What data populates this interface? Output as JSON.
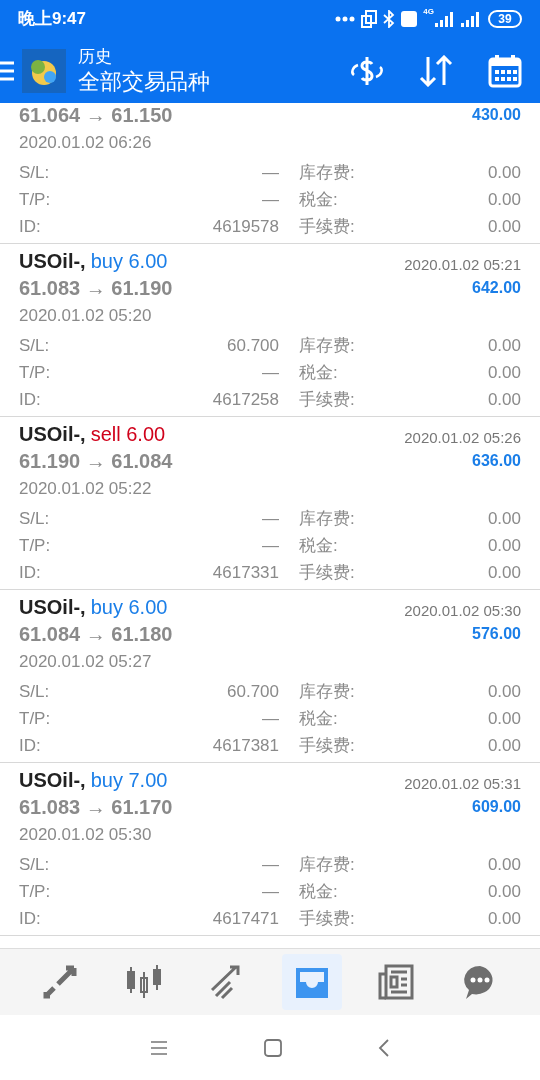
{
  "status_bar": {
    "time": "晚上9:47",
    "network": "4G",
    "battery": "39"
  },
  "header": {
    "title": "历史",
    "subtitle": "全部交易品种"
  },
  "trades": [
    {
      "prices": "61.064 → 61.150",
      "profit": "430.00",
      "open_time": "2020.01.02 06:26",
      "rows": [
        {
          "label": "S/L:",
          "value": "—",
          "label2": "库存费:",
          "value2": "0.00"
        },
        {
          "label": "T/P:",
          "value": "—",
          "label2": "税金:",
          "value2": "0.00"
        },
        {
          "label": "ID:",
          "value": "4619578",
          "label2": "手续费:",
          "value2": "0.00"
        }
      ]
    },
    {
      "symbol": "USOil-,",
      "kind": "buy",
      "action": "buy 6.00",
      "close_time": "2020.01.02 05:21",
      "prices": "61.083 → 61.190",
      "profit": "642.00",
      "open_time": "2020.01.02 05:20",
      "rows": [
        {
          "label": "S/L:",
          "value": "60.700",
          "label2": "库存费:",
          "value2": "0.00"
        },
        {
          "label": "T/P:",
          "value": "—",
          "label2": "税金:",
          "value2": "0.00"
        },
        {
          "label": "ID:",
          "value": "4617258",
          "label2": "手续费:",
          "value2": "0.00"
        }
      ]
    },
    {
      "symbol": "USOil-,",
      "kind": "sell",
      "action": "sell 6.00",
      "close_time": "2020.01.02 05:26",
      "prices": "61.190 → 61.084",
      "profit": "636.00",
      "open_time": "2020.01.02 05:22",
      "rows": [
        {
          "label": "S/L:",
          "value": "—",
          "label2": "库存费:",
          "value2": "0.00"
        },
        {
          "label": "T/P:",
          "value": "—",
          "label2": "税金:",
          "value2": "0.00"
        },
        {
          "label": "ID:",
          "value": "4617331",
          "label2": "手续费:",
          "value2": "0.00"
        }
      ]
    },
    {
      "symbol": "USOil-,",
      "kind": "buy",
      "action": "buy 6.00",
      "close_time": "2020.01.02 05:30",
      "prices": "61.084 → 61.180",
      "profit": "576.00",
      "open_time": "2020.01.02 05:27",
      "rows": [
        {
          "label": "S/L:",
          "value": "60.700",
          "label2": "库存费:",
          "value2": "0.00"
        },
        {
          "label": "T/P:",
          "value": "—",
          "label2": "税金:",
          "value2": "0.00"
        },
        {
          "label": "ID:",
          "value": "4617381",
          "label2": "手续费:",
          "value2": "0.00"
        }
      ]
    },
    {
      "symbol": "USOil-,",
      "kind": "buy",
      "action": "buy 7.00",
      "close_time": "2020.01.02 05:31",
      "prices": "61.083 → 61.170",
      "profit": "609.00",
      "open_time": "2020.01.02 05:30",
      "rows": [
        {
          "label": "S/L:",
          "value": "—",
          "label2": "库存费:",
          "value2": "0.00"
        },
        {
          "label": "T/P:",
          "value": "—",
          "label2": "税金:",
          "value2": "0.00"
        },
        {
          "label": "ID:",
          "value": "4617471",
          "label2": "手续费:",
          "value2": "0.00"
        }
      ]
    }
  ],
  "nav": [
    {
      "kind": "trade",
      "selected": false
    },
    {
      "kind": "chart",
      "selected": false
    },
    {
      "kind": "signals",
      "selected": false
    },
    {
      "kind": "history",
      "selected": true
    },
    {
      "kind": "news",
      "selected": false
    },
    {
      "kind": "chat",
      "selected": false
    }
  ]
}
